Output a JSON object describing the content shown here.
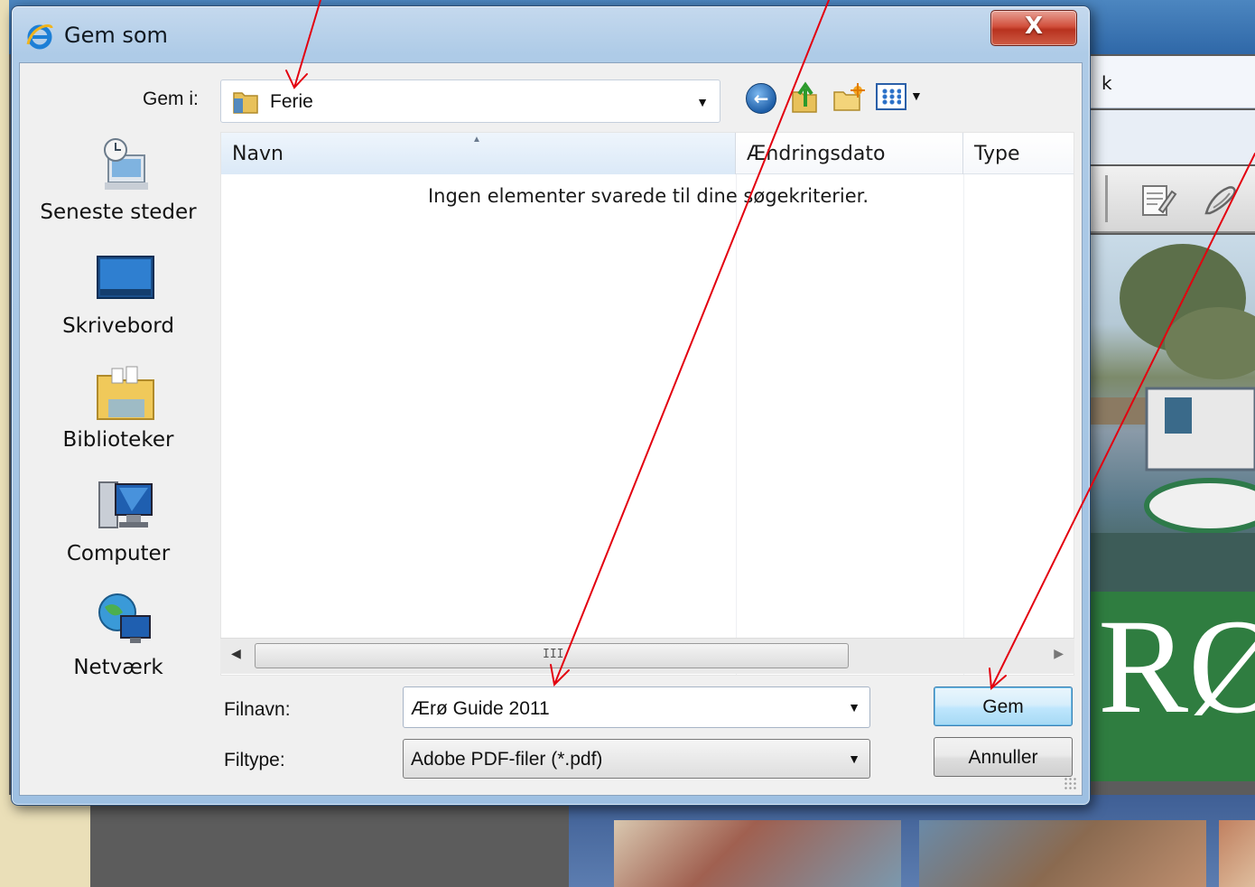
{
  "dialog": {
    "title": "Gem som",
    "close_glyph": "X",
    "save_in": {
      "label": "Gem i:",
      "value": "Ferie"
    },
    "places": [
      {
        "label": "Seneste steder",
        "icon": "recent-places-icon"
      },
      {
        "label": "Skrivebord",
        "icon": "desktop-icon"
      },
      {
        "label": "Biblioteker",
        "icon": "libraries-icon"
      },
      {
        "label": "Computer",
        "icon": "computer-icon"
      },
      {
        "label": "Netværk",
        "icon": "network-icon"
      }
    ],
    "columns": [
      "Navn",
      "Ændringsdato",
      "Type"
    ],
    "empty_message": "Ingen elementer svarede til dine søgekriterier.",
    "scroll_grip": "III",
    "filename": {
      "label": "Filnavn:",
      "value": "Ærø Guide 2011"
    },
    "filetype": {
      "label": "Filtype:",
      "value": "Adobe PDF-filer (*.pdf)"
    },
    "buttons": {
      "save": "Gem",
      "cancel": "Annuller"
    }
  },
  "background": {
    "menu_fragment": "k",
    "banner_text": "RØ"
  },
  "colors": {
    "annotation": "#e3000f",
    "banner_green": "#2f7d40",
    "save_button_border": "#3c7fb1"
  }
}
